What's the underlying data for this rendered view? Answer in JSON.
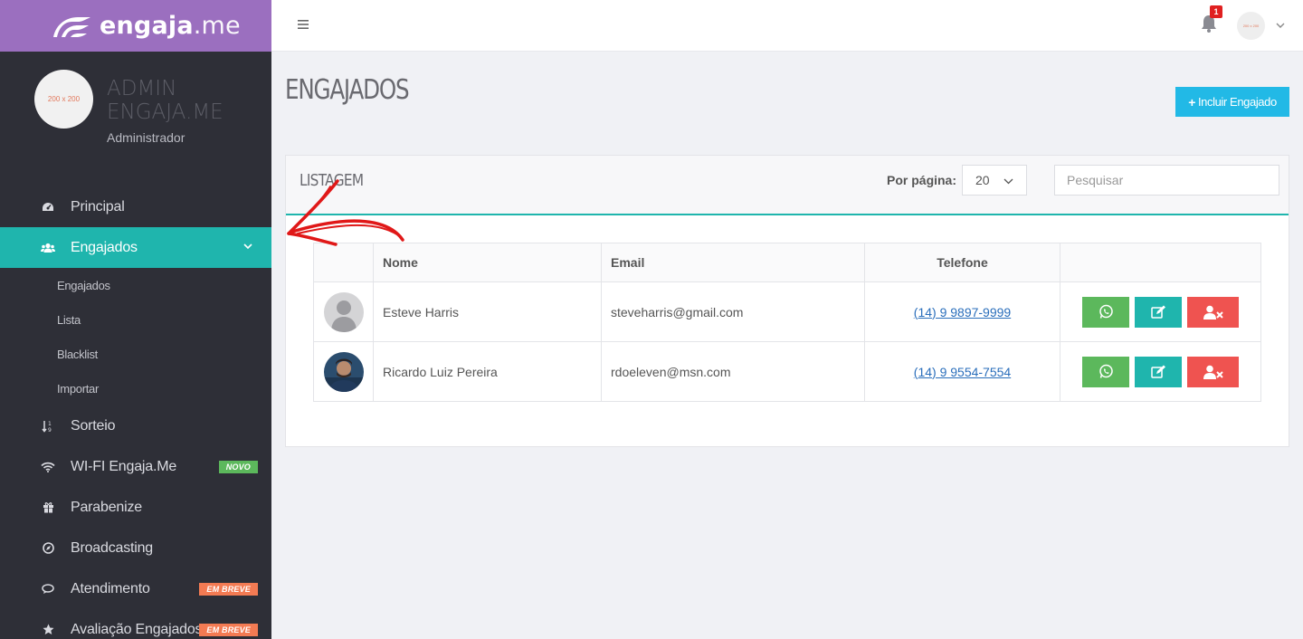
{
  "brand": {
    "bold": "engaja",
    "light": ".me"
  },
  "profile": {
    "avatar_text": "200 x 200",
    "name_line1": "ADMIN",
    "name_line2": "ENGAJA.ME",
    "role": "Administrador"
  },
  "sidebar": {
    "items": [
      {
        "label": "Principal",
        "icon": "dashboard-icon"
      },
      {
        "label": "Engajados",
        "icon": "users-icon"
      },
      {
        "label": "Sorteio",
        "icon": "sort-numeric-icon"
      },
      {
        "label": "WI-FI Engaja.Me",
        "icon": "wifi-icon",
        "badge": "NOVO"
      },
      {
        "label": "Parabenize",
        "icon": "gift-icon"
      },
      {
        "label": "Broadcasting",
        "icon": "compass-icon"
      },
      {
        "label": "Atendimento",
        "icon": "chat-icon",
        "badge": "EM BREVE"
      },
      {
        "label": "Avaliação Engajados",
        "icon": "star-icon",
        "badge": "EM BREVE"
      }
    ],
    "submenu": [
      "Engajados",
      "Lista",
      "Blacklist",
      "Importar"
    ]
  },
  "topbar": {
    "notification_count": "1",
    "user_avatar_text": "200 x 200"
  },
  "page": {
    "title": "ENGAJADOS",
    "include_button": "Incluir Engajado"
  },
  "panel": {
    "title": "LISTAGEM",
    "per_page_label": "Por página:",
    "per_page_value": "20",
    "search_placeholder": "Pesquisar"
  },
  "table": {
    "headers": [
      "",
      "Nome",
      "Email",
      "Telefone",
      ""
    ],
    "rows": [
      {
        "nome": "Esteve Harris",
        "email": "steveharris@gmail.com",
        "telefone": "(14) 9 9897-9999"
      },
      {
        "nome": "Ricardo Luiz Pereira",
        "email": "rdoeleven@msn.com",
        "telefone": "(14) 9 9554-7554"
      }
    ]
  },
  "colors": {
    "brand_purple": "#9b6fbf",
    "sidebar_bg": "#2e2f37",
    "accent_teal": "#1fb5ad",
    "primary_blue": "#22b9e6",
    "success_green": "#5cb85c",
    "danger_red": "#ef5350",
    "badge_orange": "#f37b53"
  }
}
